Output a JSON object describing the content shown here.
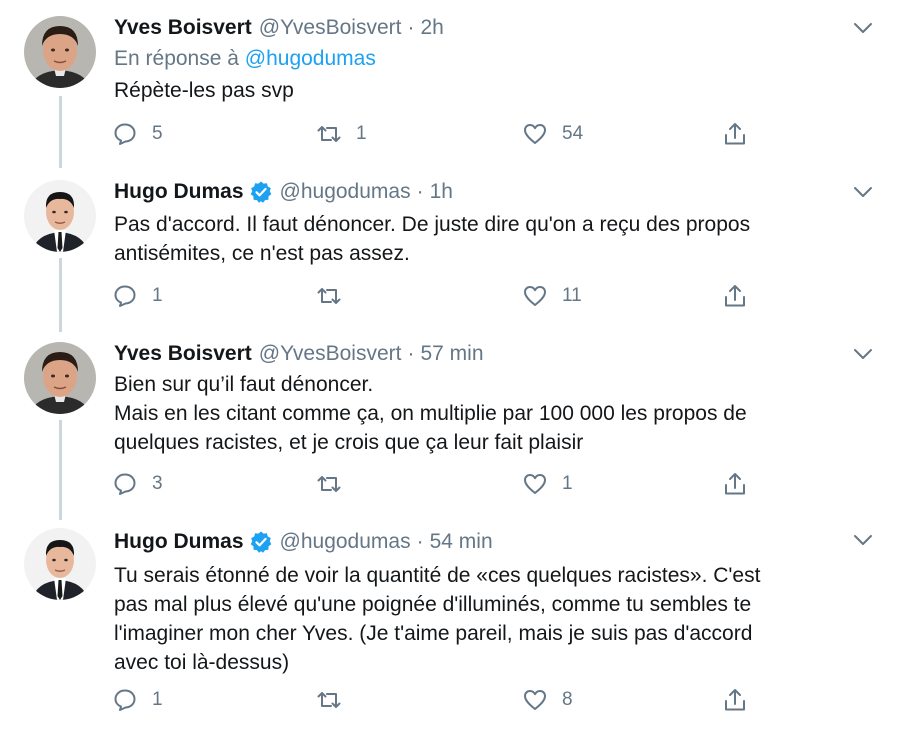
{
  "tweets": [
    {
      "name": "Yves Boisvert",
      "handle": "@YvesBoisvert",
      "separator": "·",
      "time": "2h",
      "reply_prefix": "En réponse à ",
      "reply_mention": "@hugodumas",
      "lines": [
        "Répète-les pas svp"
      ],
      "replies": "5",
      "retweets": "1",
      "likes": "54"
    },
    {
      "name": "Hugo Dumas",
      "handle": "@hugodumas",
      "separator": "·",
      "time": "1h",
      "lines": [
        "Pas d'accord. Il faut dénoncer. De juste dire qu'on a reçu des propos",
        "antisémites, ce n'est pas assez."
      ],
      "replies": "1",
      "retweets": "",
      "likes": "11"
    },
    {
      "name": "Yves Boisvert",
      "handle": "@YvesBoisvert",
      "separator": "·",
      "time": "57 min",
      "lines": [
        "Bien sur qu’il faut dénoncer.",
        "Mais en les citant comme ça, on multiplie par 100 000 les propos de",
        "quelques racistes, et je crois que ça leur fait plaisir"
      ],
      "replies": "3",
      "retweets": "",
      "likes": "1"
    },
    {
      "name": "Hugo Dumas",
      "handle": "@hugodumas",
      "separator": "·",
      "time": "54 min",
      "lines": [
        "Tu serais étonné de voir la quantité de «ces quelques racistes». C'est",
        "pas mal plus élevé qu'une poignée d'illuminés, comme tu sembles te",
        "l'imaginer mon cher Yves. (Je t'aime pareil, mais je suis pas d'accord",
        "avec toi là-dessus)"
      ],
      "replies": "1",
      "retweets": "",
      "likes": "8"
    }
  ],
  "icons": {
    "reply": "reply-icon",
    "retweet": "retweet-icon",
    "like": "heart-icon",
    "share": "share-icon",
    "caret": "chevron-down-icon",
    "verified": "verified-badge-icon"
  },
  "colors": {
    "text": "#14171a",
    "secondary": "#657786",
    "accent": "#1da1f2",
    "thread_line": "#ccd6dd"
  }
}
